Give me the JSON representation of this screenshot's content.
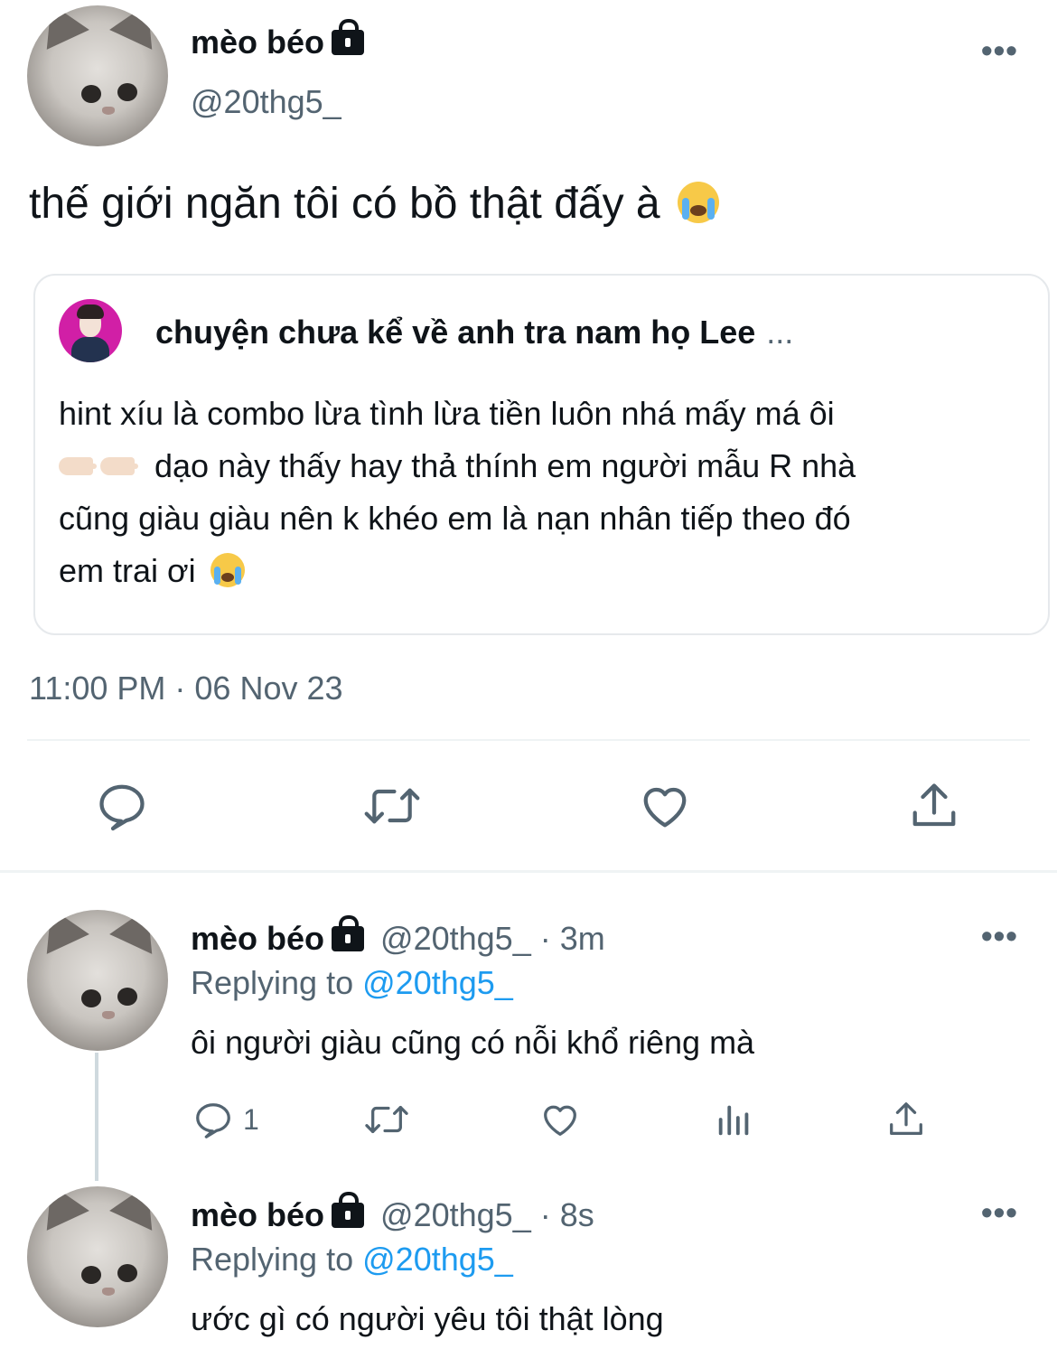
{
  "main_tweet": {
    "display_name": "mèo béo",
    "handle": "@20thg5_",
    "text": "thế giới ngăn tôi có bồ thật đấy à",
    "more_label": "•••",
    "timestamp": "11:00 PM · 06 Nov 23"
  },
  "quoted_tweet": {
    "display_name": "chuyện chưa kể về anh tra nam họ Lee",
    "ellipsis": "...",
    "line1": "hint xíu là combo lừa tình lừa tiền luôn nhá mấy má ôi",
    "line2": "dạo này thấy hay thả thính em người mẫu R nhà",
    "line3": "cũng giàu giàu nên k khéo em là nạn nhân tiếp theo đó",
    "line4": "em trai ơi"
  },
  "main_actions": [
    "reply-icon",
    "retweet-icon",
    "like-icon",
    "share-icon"
  ],
  "replies": [
    {
      "display_name": "mèo béo",
      "handle": "@20thg5_",
      "separator": "·",
      "time": "3m",
      "replying_label": "Replying to",
      "replying_to": "@20thg5_",
      "text": "ôi người giàu cũng có nỗi khổ riêng mà",
      "reply_count": "1",
      "more_label": "•••"
    },
    {
      "display_name": "mèo béo",
      "handle": "@20thg5_",
      "separator": "·",
      "time": "8s",
      "replying_label": "Replying to",
      "replying_to": "@20thg5_",
      "text": "ước gì có người yêu tôi thật lòng",
      "more_label": "•••"
    }
  ],
  "colors": {
    "text_primary": "#0f1419",
    "text_secondary": "#536471",
    "link": "#1d9bf0",
    "divider": "#eff3f4"
  }
}
